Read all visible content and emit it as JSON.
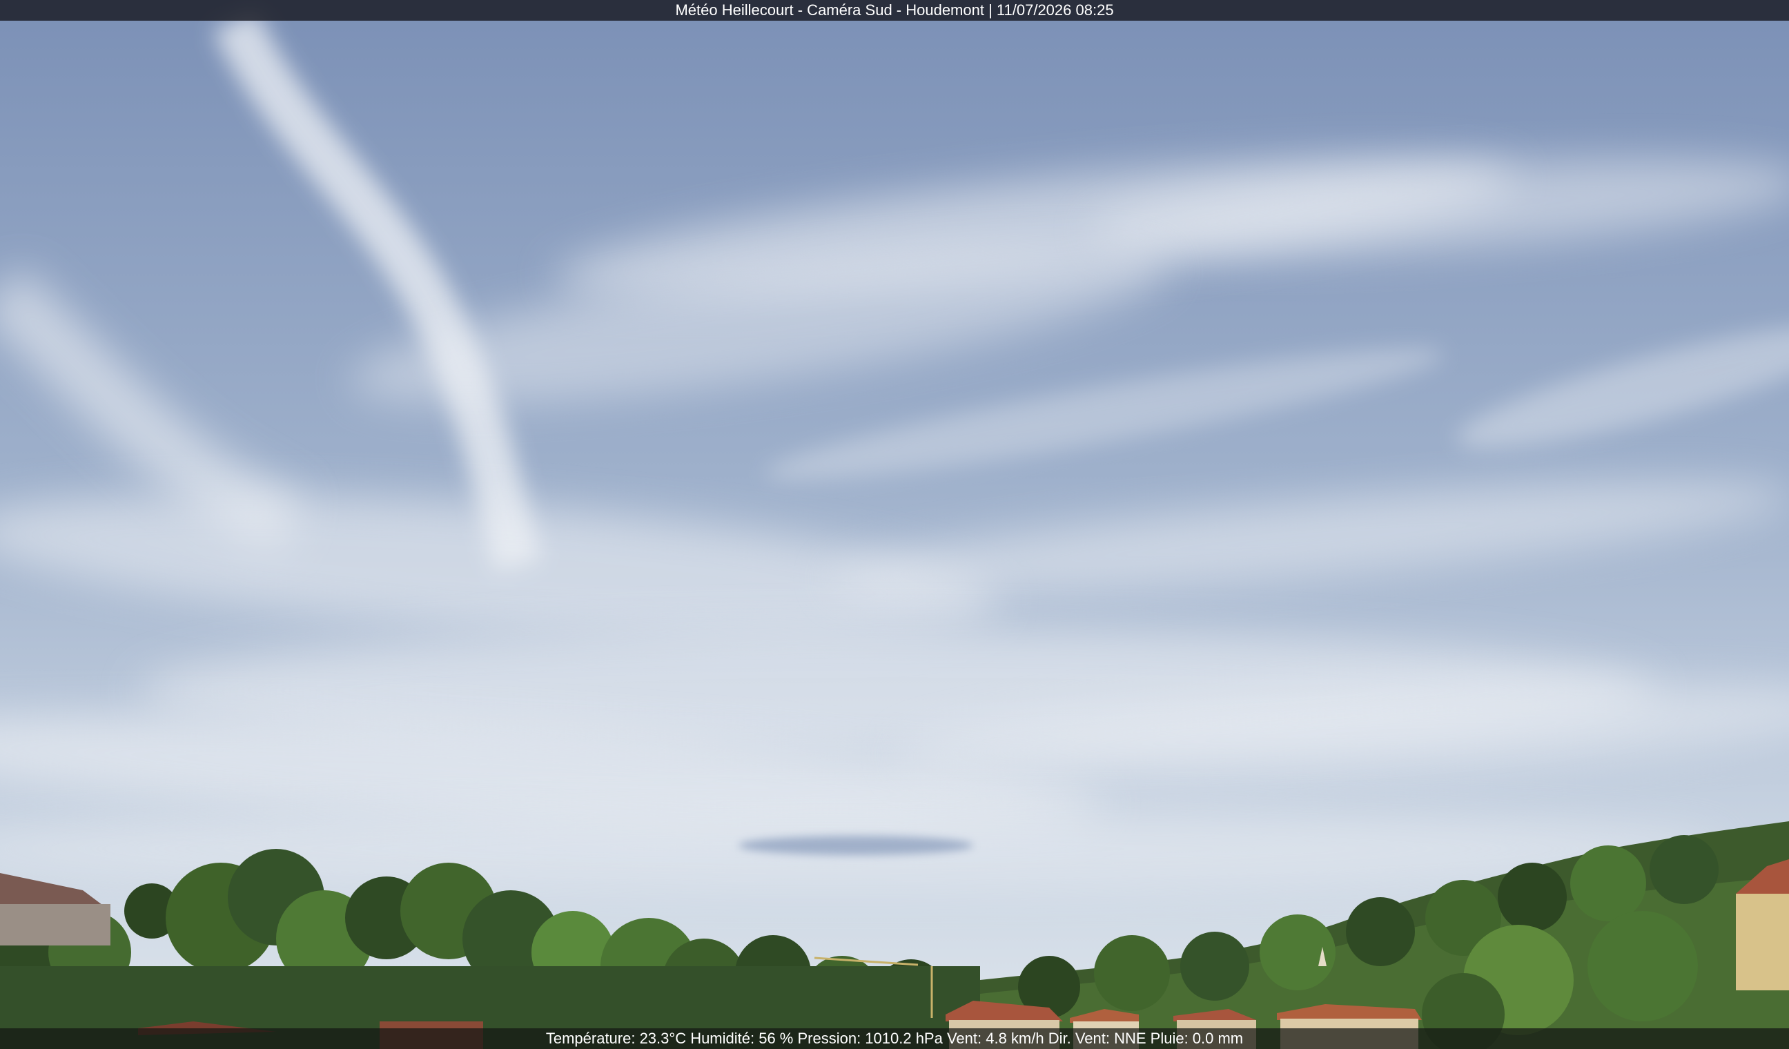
{
  "header": {
    "caption": "Météo Heillecourt - Caméra Sud - Houdemont | 11/07/2026 08:25"
  },
  "footer": {
    "weather_line": "Température: 23.3°C  Humidité: 56 % Pression: 1010.2 hPa Vent: 4.8 km/h Dir. Vent: NNE Pluie: 0.0 mm"
  },
  "colors": {
    "sky_top": "#7d93ba",
    "sky_mid": "#a9bad3",
    "sky_horizon": "#d9e1ea",
    "cloud": "#eef1f5",
    "foliage_dark": "#2f4a24",
    "foliage_light": "#5f8a3c",
    "roof": "#a8553d",
    "wall": "#d8c28a"
  }
}
